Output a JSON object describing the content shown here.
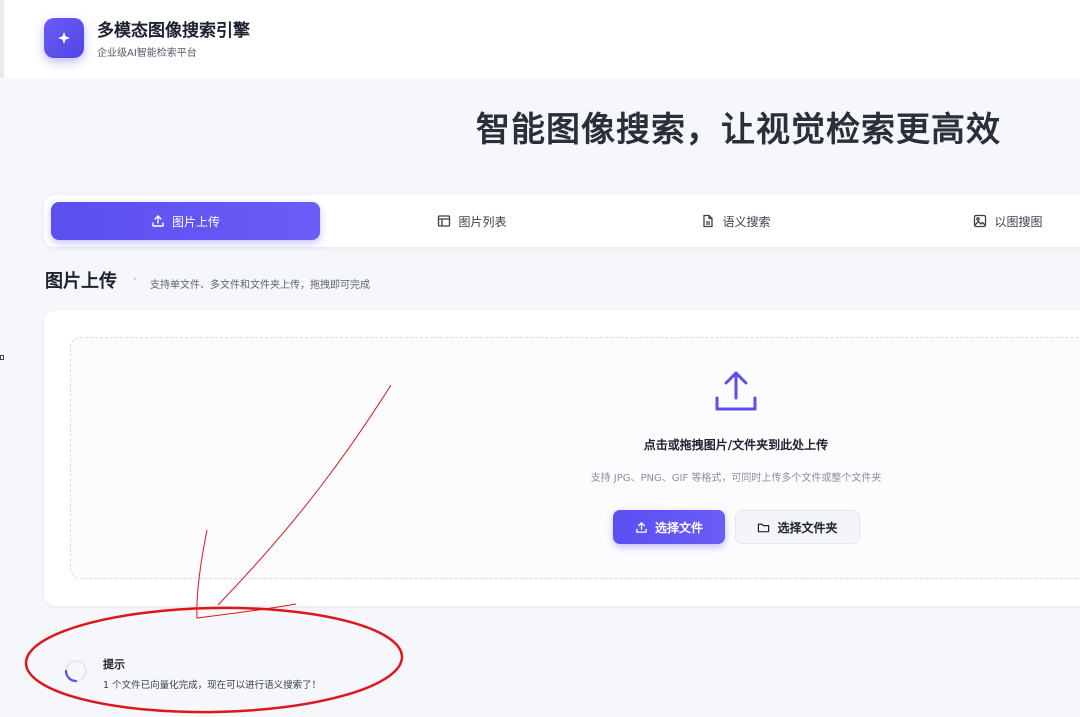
{
  "header": {
    "title": "多模态图像搜索引擎",
    "subtitle": "企业级AI智能检索平台"
  },
  "hero": {
    "headline": "智能图像搜索，让视觉检索更高效"
  },
  "tabs": [
    {
      "label": "图片上传",
      "icon": "upload-icon",
      "active": true
    },
    {
      "label": "图片列表",
      "icon": "table-icon",
      "active": false
    },
    {
      "label": "语义搜索",
      "icon": "document-icon",
      "active": false
    },
    {
      "label": "以图搜图",
      "icon": "image-icon",
      "active": false
    }
  ],
  "section": {
    "title": "图片上传",
    "separator": "·",
    "description": "支持单文件、多文件和文件夹上传，拖拽即可完成"
  },
  "dropzone": {
    "title": "点击或拖拽图片/文件夹到此处上传",
    "hint": "支持 JPG、PNG、GIF 等格式，可同时上传多个文件或整个文件夹",
    "select_file_label": "选择文件",
    "select_folder_label": "选择文件夹"
  },
  "toast": {
    "title": "提示",
    "message": "1 个文件已向量化完成，现在可以进行语义搜索了！"
  },
  "colors": {
    "accent": "#5b4ff0",
    "annotation": "#e0161b"
  }
}
